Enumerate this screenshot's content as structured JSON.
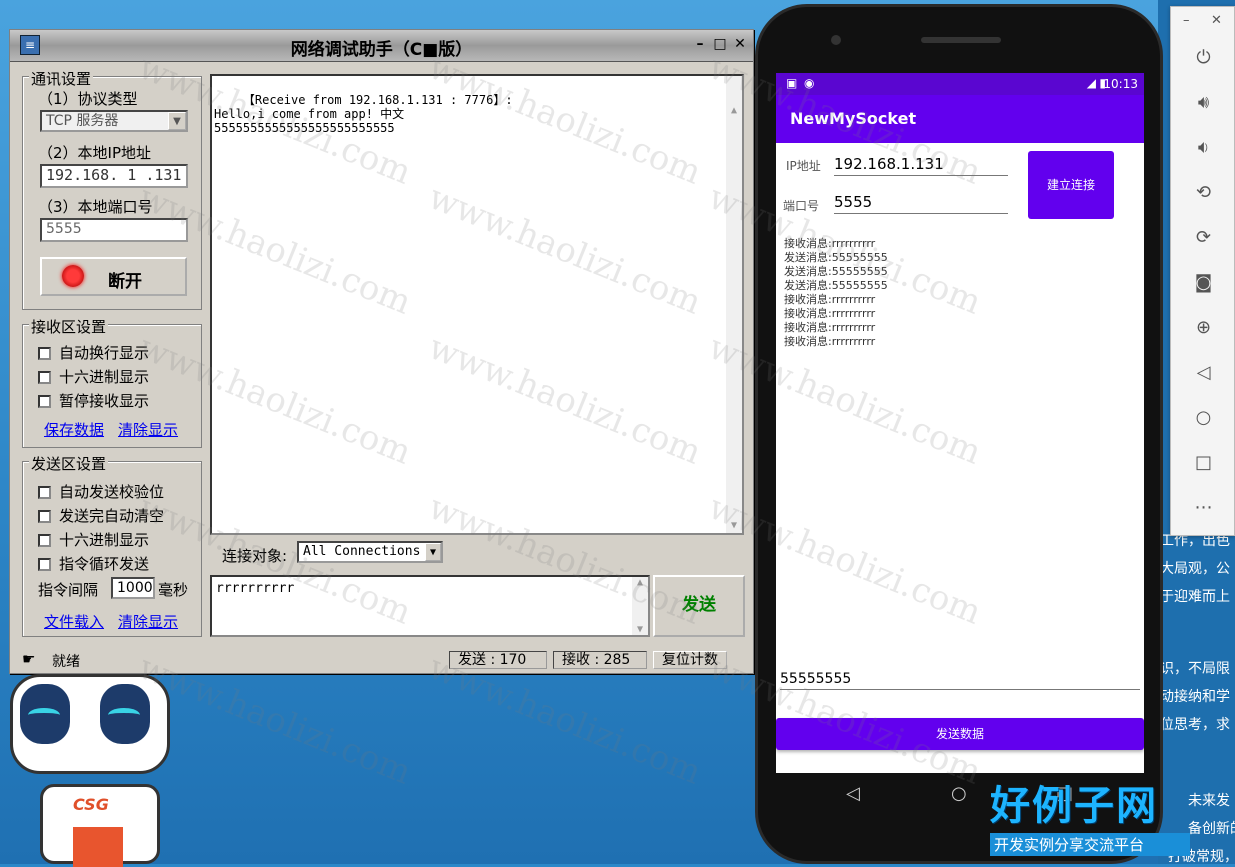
{
  "win": {
    "title": "网络调试助手（C■版）",
    "comm": {
      "title": "通讯设置",
      "proto_label": "（1）协议类型",
      "proto_value": "TCP 服务器",
      "ip_label": "（2）本地IP地址",
      "ip_value": "192.168. 1 .131",
      "port_label": "（3）本地端口号",
      "port_value": "5555",
      "disconnect_label": "断开"
    },
    "recv_settings": {
      "title": "接收区设置",
      "options": [
        "自动换行显示",
        "十六进制显示",
        "暂停接收显示"
      ],
      "save_link": "保存数据",
      "clear_link": "清除显示"
    },
    "send_settings": {
      "title": "发送区设置",
      "options": [
        "自动发送校验位",
        "发送完自动清空",
        "十六进制显示",
        "指令循环发送"
      ],
      "interval_label": "指令间隔",
      "interval_value": "1000",
      "interval_unit": "毫秒",
      "load_link": "文件载入",
      "clear_link": "清除显示"
    },
    "recv_text": "【Receive from 192.168.1.131 : 7776】:\nHello,i come from app! 中文\n5555555555555555555555555",
    "target_label": "连接对象:",
    "target_value": "All Connections",
    "send_text": "rrrrrrrrrr",
    "send_button": "发送",
    "status_text": "就绪",
    "sent_count": "发送 : 170",
    "recv_count": "接收 : 285",
    "reset_label": "复位计数"
  },
  "phone": {
    "time": "10:13",
    "app_title": "NewMySocket",
    "ip_label": "IP地址",
    "ip_value": "192.168.1.131",
    "port_label": "端口号",
    "port_value": "5555",
    "connect_button": "建立连接",
    "log": [
      "接收消息:rrrrrrrrrr",
      "发送消息:55555555",
      "发送消息:55555555",
      "发送消息:55555555",
      "接收消息:rrrrrrrrrr",
      "接收消息:rrrrrrrrrr",
      "接收消息:rrrrrrrrrr",
      "接收消息:rrrrrrrrrr"
    ],
    "message_value": "55555555",
    "send_button": "发送数据"
  },
  "desktop": {
    "right_lines": [
      "工作，出色",
      "大局观，公",
      "于迎难而上",
      "识，不局限",
      "动接纳和学",
      "位思考，求",
      "未来发",
      "备创新的能",
      "打破常规，优"
    ],
    "logo_title": "好例子网",
    "logo_sub": "开发实例分享交流平台",
    "robot_badge": "CSG",
    "watermark": "www.haolizi.com"
  },
  "colors": {
    "accent": "#6200ee",
    "status_bar": "#5a06d0",
    "send_green": "#008000"
  }
}
